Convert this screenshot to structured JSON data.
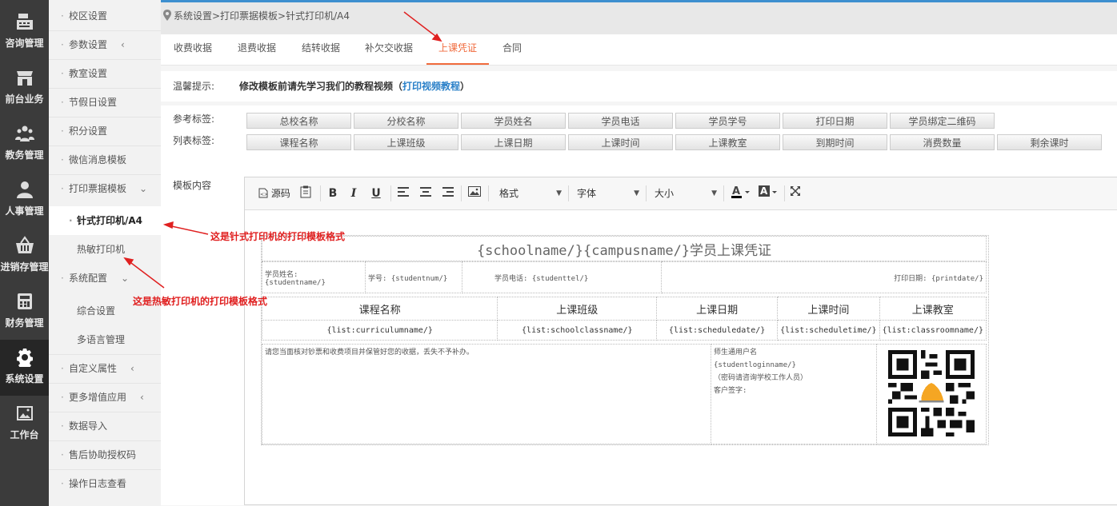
{
  "rail": [
    {
      "label": "咨询管理",
      "icon": "cash-register-icon"
    },
    {
      "label": "前台业务",
      "icon": "storefront-icon"
    },
    {
      "label": "教务管理",
      "icon": "people-group-icon"
    },
    {
      "label": "人事管理",
      "icon": "person-icon"
    },
    {
      "label": "进销存管理",
      "icon": "basket-icon"
    },
    {
      "label": "财务管理",
      "icon": "calculator-icon"
    },
    {
      "label": "系统设置",
      "icon": "gear-icon"
    },
    {
      "label": "工作台",
      "icon": "picture-icon"
    }
  ],
  "submenu": {
    "items": [
      {
        "label": "校区设置"
      },
      {
        "label": "参数设置",
        "chevron": "‹"
      },
      {
        "label": "教室设置"
      },
      {
        "label": "节假日设置"
      },
      {
        "label": "积分设置"
      },
      {
        "label": "微信消息模板"
      },
      {
        "label": "打印票据模板",
        "chevron": "⌄"
      },
      {
        "label": "针式打印机/A4"
      },
      {
        "label": "热敏打印机"
      },
      {
        "label": "系统配置",
        "chevron": "⌄"
      },
      {
        "label": "综合设置"
      },
      {
        "label": "多语言管理"
      },
      {
        "label": "自定义属性",
        "chevron": "‹"
      },
      {
        "label": "更多增值应用",
        "chevron": "‹"
      },
      {
        "label": "数据导入"
      },
      {
        "label": "售后协助授权码"
      },
      {
        "label": "操作日志查看"
      }
    ]
  },
  "breadcrumb": "系统设置>打印票据模板>针式打印机/A4",
  "tabs": [
    "收费收据",
    "退费收据",
    "结转收据",
    "补欠交收据",
    "上课凭证",
    "合同"
  ],
  "active_tab": "上课凭证",
  "hint": {
    "label": "温馨提示:",
    "text": "修改模板前请先学习我们的教程视频（",
    "link": "打印视频教程",
    "text_end": "）"
  },
  "tags": {
    "ref_label": "参考标签:",
    "list_label": "列表标签:",
    "ref_buttons": [
      "总校名称",
      "分校名称",
      "学员姓名",
      "学员电话",
      "学员学号",
      "打印日期",
      "学员绑定二维码"
    ],
    "list_buttons": [
      "课程名称",
      "上课班级",
      "上课日期",
      "上课时间",
      "上课教室",
      "到期时间",
      "消费数量",
      "剩余课时"
    ],
    "content_label": "模板内容"
  },
  "toolbar": {
    "source": "源码",
    "format": "格式",
    "font": "字体",
    "size": "大小"
  },
  "doc": {
    "title": "{schoolname/}{campusname/}学员上课凭证",
    "student_name_label": "学员姓名:",
    "student_name": "{studentname/}",
    "student_num": "学号: {studentnum/}",
    "student_tel": "学员电话: {studenttel/}",
    "print_date": "打印日期: {printdate/}",
    "headers": [
      "课程名称",
      "上课班级",
      "上课日期",
      "上课时间",
      "上课教室"
    ],
    "cells": [
      "{list:curriculumname/}",
      "{list:schoolclassname/}",
      "{list:scheduledate/}",
      "{list:scheduletime/}",
      "{list:classroomname/}"
    ],
    "note": "请您当面核对钞票和收费项目并保管好您的收据，丢失不予补办。",
    "login_label": "师生通用户名",
    "login": "{studentloginname/}",
    "pwd_hint": "（密码请咨询学校工作人员）",
    "sign": "客户签字:"
  },
  "annotations": {
    "a1": "这是针式打印机的打印模板格式",
    "a2": "这是热敏打印机的打印模板格式"
  },
  "colors": {
    "accent": "#f06a3c",
    "link": "#2a80c8",
    "annotation": "#e02020"
  }
}
